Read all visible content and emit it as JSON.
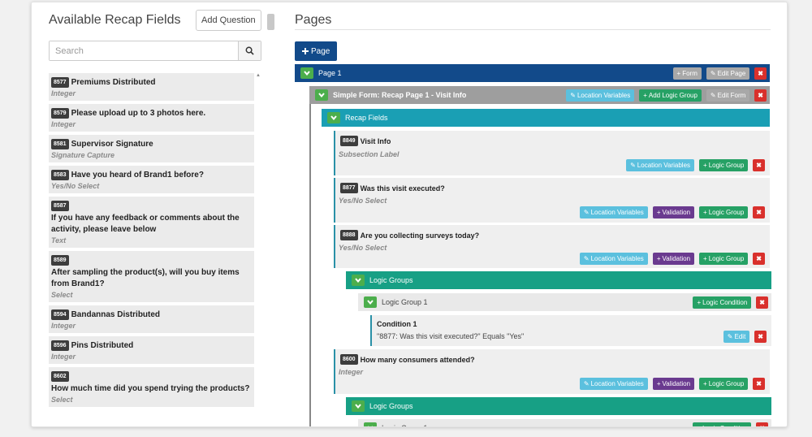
{
  "left_panel": {
    "title": "Available Recap Fields",
    "add_question_label": "Add Question",
    "search_placeholder": "Search",
    "fields": [
      {
        "id": "8577",
        "label": "Premiums Distributed",
        "type": "Integer",
        "inline": true
      },
      {
        "id": "8579",
        "label": "Please upload up to 3 photos here.",
        "type": "Integer",
        "inline": true
      },
      {
        "id": "8581",
        "label": "Supervisor Signature",
        "type": "Signature Capture",
        "inline": true
      },
      {
        "id": "8583",
        "label": "Have you heard of Brand1 before?",
        "type": "Yes/No Select",
        "inline": true
      },
      {
        "id": "8587",
        "label": "If you have any feedback or comments about the activity, please leave below",
        "type": "Text",
        "inline": false
      },
      {
        "id": "8589",
        "label": "After sampling the product(s), will you buy items from Brand1?",
        "type": "Select",
        "inline": false
      },
      {
        "id": "8594",
        "label": "Bandannas Distributed",
        "type": "Integer",
        "inline": true
      },
      {
        "id": "8596",
        "label": "Pins Distributed",
        "type": "Integer",
        "inline": true
      },
      {
        "id": "8602",
        "label": "How much time did you spend trying the products?",
        "type": "Select",
        "inline": false
      }
    ]
  },
  "right_panel": {
    "title": "Pages",
    "add_page_label": "Page",
    "page": {
      "title": "Page 1",
      "form_btn": "Form",
      "edit_btn": "Edit Page",
      "delete": "✖"
    },
    "form": {
      "title": "Simple Form: Recap Page 1 - Visit Info",
      "location_btn": "Location Variables",
      "logic_btn": "Add Logic Group",
      "edit_btn": "Edit Form",
      "delete": "✖"
    },
    "recap_fields_label": "Recap Fields",
    "items": [
      {
        "id": "8849",
        "title": "Visit Info",
        "type": "Subsection Label"
      },
      {
        "id": "8877",
        "title": "Was this visit executed?",
        "type": "Yes/No Select"
      },
      {
        "id": "8888",
        "title": "Are you collecting surveys today?",
        "type": "Yes/No Select"
      },
      {
        "id": "8600",
        "title": "How many consumers attended?",
        "type": "Integer"
      }
    ],
    "location_btn": "Location Variables",
    "validation_btn": "Validation",
    "logic_group_btn": "Logic Group",
    "logic_groups_label": "Logic Groups",
    "logic_group_1": "Logic Group 1",
    "logic_condition_btn": "Logic Condition",
    "condition": {
      "title": "Condition 1",
      "text": "\"8877: Was this visit executed?\" Equals \"Yes\"",
      "edit_btn": "Edit"
    },
    "delete": "✖"
  },
  "colors": {
    "page_bar": "#124a8a",
    "form_bar": "#9e9e9e",
    "recap_bar": "#1a9fb4",
    "logic_bar": "#17a085",
    "toggle": "#4cae4c"
  },
  "icons": {
    "search": "search-icon",
    "plus": "plus-icon",
    "edit": "edit-icon",
    "close": "close-icon",
    "chevron": "chevron-down-icon"
  }
}
